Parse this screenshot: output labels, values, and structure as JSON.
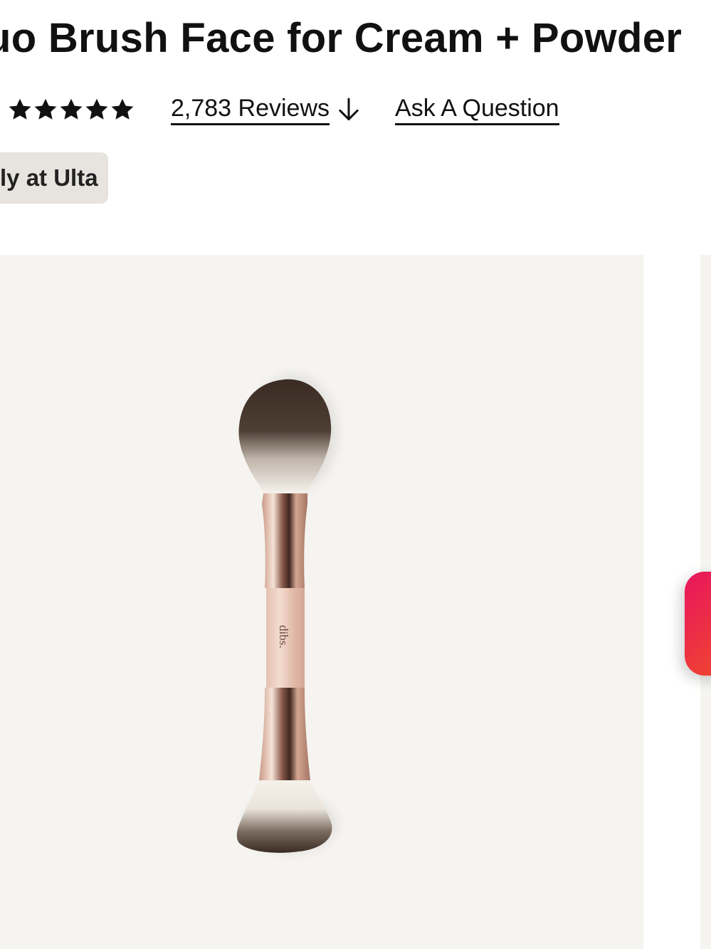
{
  "product": {
    "title": "uo Brush Face for Cream + Powder",
    "rating_value": 5,
    "rating_max": 5,
    "reviews_label": "2,783 Reviews",
    "ask_label": "Ask A Question",
    "badge_label": "ly at Ulta",
    "image_brand_text": "dibs."
  },
  "icons": {
    "star": "star-icon",
    "reviews_arrow": "arrow-down-icon"
  },
  "colors": {
    "badge_bg": "#e7e4df",
    "hero_bg": "#f5f4f1",
    "float_button": "#e8155e"
  }
}
